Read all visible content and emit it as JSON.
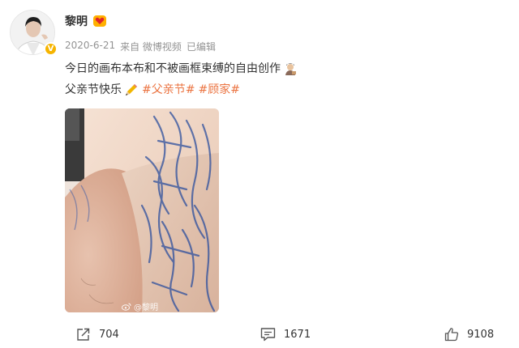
{
  "user": {
    "name": "黎明",
    "verified_symbol": "V"
  },
  "meta": {
    "date": "2020-6-21",
    "source": "来自 微博视频",
    "edited": "已编辑"
  },
  "post": {
    "line1": "今日的画布本布和不被画框束缚的自由创作",
    "line2_text": "父亲节快乐",
    "hashtags": [
      "#父亲节#",
      "#顾家#"
    ]
  },
  "image": {
    "watermark": "@黎明"
  },
  "actions": {
    "repost_count": "704",
    "comment_count": "1671",
    "like_count": "9108"
  },
  "colors": {
    "hashtag": "#eb7340",
    "meta_gray": "#939393",
    "verified_badge": "#f6b400"
  },
  "icons": {
    "repost": "share-arrow-icon",
    "comment": "comment-bubble-icon",
    "like": "thumbs-up-icon"
  }
}
